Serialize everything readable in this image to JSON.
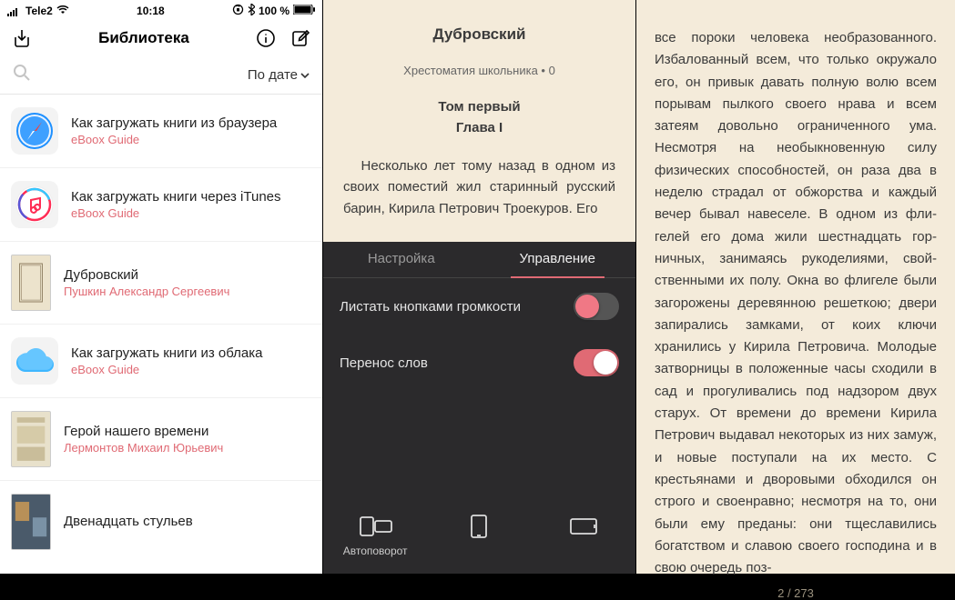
{
  "statusbar": {
    "carrier": "Tele2",
    "time": "10:18",
    "battery": "100 %"
  },
  "navbar": {
    "title": "Библиотека"
  },
  "search": {
    "sort_label": "По дате"
  },
  "books": [
    {
      "title": "Как загружать книги из браузера",
      "author": "eBoox Guide"
    },
    {
      "title": "Как загружать книги через iTunes",
      "author": "eBoox Guide"
    },
    {
      "title": "Дубровский",
      "author": "Пушкин Александр Сергеевич"
    },
    {
      "title": "Как загружать книги из облака",
      "author": "eBoox Guide"
    },
    {
      "title": "Герой нашего времени",
      "author": "Лермонтов Михаил Юрьевич"
    },
    {
      "title": "Двенадцать стульев",
      "author": ""
    }
  ],
  "reader": {
    "doc_title": "Дубровский",
    "meta": "Хрестоматия школьника • 0",
    "section": "Том первый",
    "chapter": "Глава I",
    "paragraph": "Несколько лет тому назад в одном из своих поместий жил старинный русский барин, Кирила Петрович Троекуров. Его"
  },
  "settings": {
    "tab_settings": "Настройка",
    "tab_control": "Управление",
    "volume_flip_label": "Листать кнопками громкости",
    "hyphenation_label": "Перенос слов",
    "autorotate_label": "Автоповорот"
  },
  "page_right": {
    "body": "все пороки человека необразованного. Избалованный всем, что только окружа­ло его, он привык давать полную волю всем порывам пылкого своего нрава и всем затеям довольно ограниченного ума. Несмотря на необыкновенную силу физических способностей, он раза два в неделю страдал от обжорства и каждый вечер бывал навеселе. В одном из фли­гелей его дома жили шестнадцать гор­ничных, занимаясь рукоделиями, свой­ственными их полу. Окна во флигеле бы­ли загорожены деревянною решеткою; двери запирались замками, от коих клю­чи хранились у Кирила Петровича. Мо­лодые затворницы в положенные часы сходили в сад и прогуливались под над­зором двух старух. От времени до вре­мени Кирила Петрович выдавал некото­рых из них замуж, и новые поступали на их место. С крестьянами и дворовыми обходился он строго и своенравно; не­смотря на то, они были ему преданы: они тщеславились богатством и славою своего господина и в свою очередь поз-",
    "footer": "2 / 273"
  }
}
